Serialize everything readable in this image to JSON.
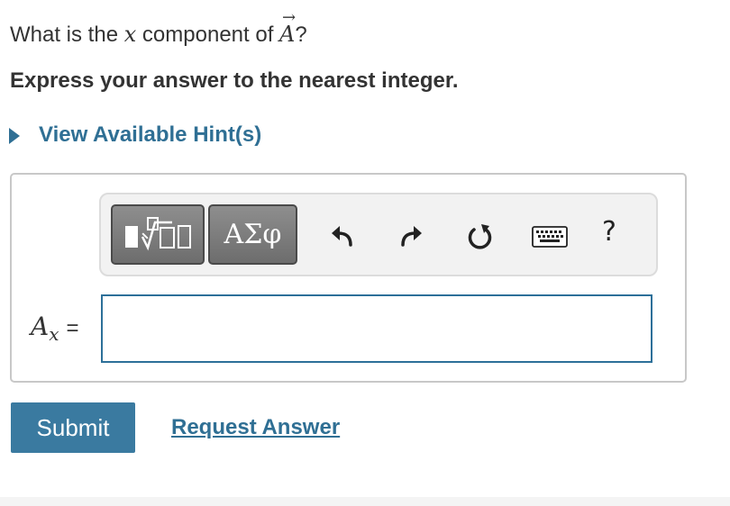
{
  "question": {
    "prefix": "What is the ",
    "x_var": "x",
    "middle": " component of ",
    "vector": "A",
    "vector_arrow": "→",
    "suffix": "?"
  },
  "instruction": "Express your answer to the nearest integer.",
  "hint": {
    "label": "View Available Hint(s)"
  },
  "toolbar": {
    "templates_icon": "templates-icon",
    "symbols_label": "ΑΣφ",
    "undo_icon": "undo-icon",
    "redo_icon": "redo-icon",
    "reset_icon": "reset-icon",
    "keyboard_icon": "keyboard-icon",
    "help_label": "?"
  },
  "answer": {
    "variable": "A",
    "subscript": "x",
    "equals": "=",
    "value": ""
  },
  "actions": {
    "submit_label": "Submit",
    "request_label": "Request Answer"
  },
  "colors": {
    "accent": "#2f6f94",
    "submit_bg": "#3a7aa0",
    "input_border": "#2d7099",
    "toolbar_button": "#7a7a7a"
  }
}
